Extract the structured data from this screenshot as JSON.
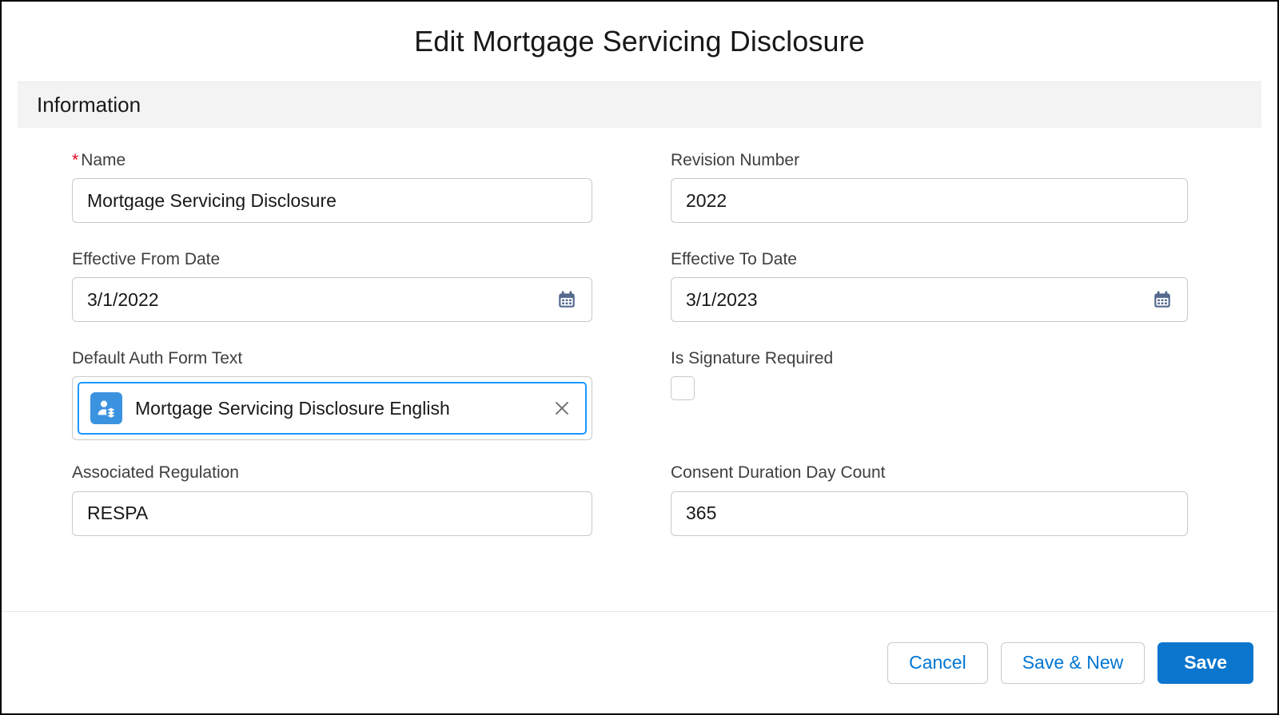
{
  "modal": {
    "title": "Edit Mortgage Servicing Disclosure"
  },
  "section": {
    "title": "Information"
  },
  "fields": {
    "name": {
      "label": "Name",
      "required_marker": "*",
      "value": "Mortgage Servicing Disclosure"
    },
    "revision_number": {
      "label": "Revision Number",
      "value": "2022"
    },
    "effective_from_date": {
      "label": "Effective From Date",
      "value": "3/1/2022",
      "icon": "calendar-icon"
    },
    "effective_to_date": {
      "label": "Effective To Date",
      "value": "3/1/2023",
      "icon": "calendar-icon"
    },
    "default_auth_form_text": {
      "label": "Default Auth Form Text",
      "pill_value": "Mortgage Servicing Disclosure English",
      "pill_icon": "record-person-layers-icon",
      "remove_icon": "close-icon"
    },
    "is_signature_required": {
      "label": "Is Signature Required",
      "checked": false
    },
    "associated_regulation": {
      "label": "Associated Regulation",
      "value": "RESPA"
    },
    "consent_duration_day_count": {
      "label": "Consent Duration Day Count",
      "value": "365"
    }
  },
  "footer": {
    "cancel_label": "Cancel",
    "save_new_label": "Save & New",
    "save_label": "Save"
  },
  "colors": {
    "brand_blue": "#0b76cd",
    "link_blue": "#0176d3",
    "focus_blue": "#1b96ff",
    "required_red": "#ea001e",
    "record_icon_blue": "#3b93e0",
    "calendar_icon": "#54698d",
    "section_bg": "#f3f3f3",
    "border_gray": "#c9c9c9"
  }
}
